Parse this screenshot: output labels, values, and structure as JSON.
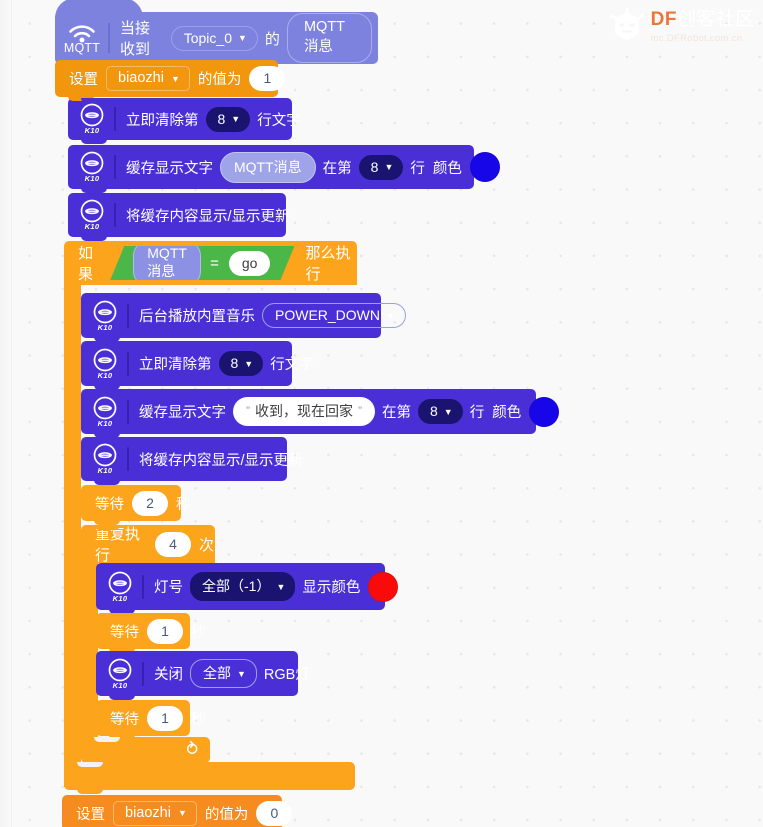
{
  "watermark": {
    "brand_df": "DF",
    "brand_cn": "创客社区",
    "site": "mc.DFRobot.com.cn",
    "logo_icon": "dfrobot-hexagon-logo-icon"
  },
  "colors": {
    "hat_block": "#7D82DE",
    "device_block": "#4B2FD6",
    "variable_block": "#F2960D",
    "control_block": "#FBA41C",
    "boolean_block": "#4BB749",
    "text_color_blue": "#1707e8",
    "led_color_red": "#fa0b0b"
  },
  "blocks": {
    "hat": {
      "icon": "mqtt-wifi-icon",
      "icon_label": "MQTT",
      "prefix": "当接收到",
      "topic": "Topic_0",
      "middle": "的",
      "message_reporter": "MQTT消息"
    },
    "set_var_top": {
      "label": "设置",
      "variable": "biaozhi",
      "mid": "的值为",
      "value": "1"
    },
    "clear_line_1": {
      "device": "K10",
      "prefix": "立即清除第",
      "line": "8",
      "suffix": "行文字"
    },
    "buffer_text_1": {
      "device": "K10",
      "prefix": "缓存显示文字",
      "content_reporter": "MQTT消息",
      "mid": "在第",
      "line": "8",
      "row_label": "行",
      "color_label": "颜色",
      "color": "#1707e8"
    },
    "flush_1": {
      "device": "K10",
      "label": "将缓存内容显示/显示更新"
    },
    "if_block": {
      "label": "如果",
      "left_operand": "MQTT消息",
      "operator": "=",
      "right_operand": "go",
      "then_label": "那么执行"
    },
    "play_music": {
      "device": "K10",
      "prefix": "后台播放内置音乐",
      "track": "POWER_DOWN"
    },
    "clear_line_2": {
      "device": "K10",
      "prefix": "立即清除第",
      "line": "8",
      "suffix": "行文字"
    },
    "buffer_text_2": {
      "device": "K10",
      "prefix": "缓存显示文字",
      "content": "收到，现在回家",
      "mid": "在第",
      "line": "8",
      "row_label": "行",
      "color_label": "颜色",
      "color": "#1707e8"
    },
    "flush_2": {
      "device": "K10",
      "label": "将缓存内容显示/显示更新"
    },
    "wait_2s": {
      "prefix": "等待",
      "value": "2",
      "suffix": "秒"
    },
    "repeat": {
      "prefix": "重复执行",
      "value": "4",
      "suffix": "次",
      "loop_arrow_icon": "loop-arrow-icon"
    },
    "led_show": {
      "device": "K10",
      "prefix": "灯号",
      "selection": "全部（-1）",
      "mid": "显示颜色",
      "color": "#fa0b0b"
    },
    "wait_1s_a": {
      "prefix": "等待",
      "value": "1",
      "suffix": "秒"
    },
    "led_off": {
      "device": "K10",
      "prefix": "关闭",
      "selection": "全部",
      "suffix": "RGB灯"
    },
    "wait_1s_b": {
      "prefix": "等待",
      "value": "1",
      "suffix": "秒"
    },
    "set_var_bottom": {
      "label": "设置",
      "variable": "biaozhi",
      "mid": "的值为",
      "value": "0"
    }
  }
}
